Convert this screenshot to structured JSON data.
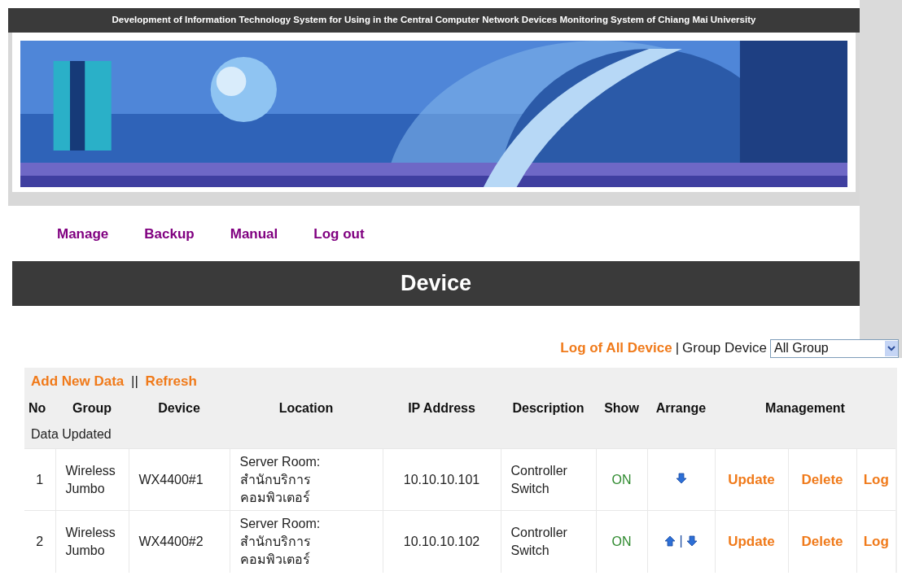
{
  "title_bar": "Development of Information Technology System for Using in the Central Computer Network Devices Monitoring System of Chiang Mai University",
  "nav": [
    "Manage",
    "Backup",
    "Manual",
    "Log out"
  ],
  "section_title": "Device",
  "filter": {
    "log_link": "Log of All Device",
    "separator": "|",
    "label": "Group Device",
    "select_value": "All Group"
  },
  "actions": {
    "add": "Add New Data",
    "separator": "||",
    "refresh": "Refresh"
  },
  "table": {
    "columns": [
      "No",
      "Group",
      "Device",
      "Location",
      "IP Address",
      "Description",
      "Show",
      "Arrange",
      "Management"
    ],
    "subheader": "Data Updated",
    "rows": [
      {
        "no": "1",
        "group": "Wireless Jumbo",
        "device": "WX4400#1",
        "location": [
          "Server Room:",
          "สำนักบริการ",
          "คอมพิวเตอร์"
        ],
        "ip": "10.10.10.101",
        "description": "Controller Switch",
        "show": "ON",
        "arrange": {
          "up": false,
          "down": true
        },
        "update": "Update",
        "delete": "Delete",
        "log": "Log"
      },
      {
        "no": "2",
        "group": "Wireless Jumbo",
        "device": "WX4400#2",
        "location": [
          "Server Room:",
          "สำนักบริการ",
          "คอมพิวเตอร์"
        ],
        "ip": "10.10.10.102",
        "description": "Controller Switch",
        "show": "ON",
        "arrange": {
          "up": true,
          "separator": "|",
          "down": true
        },
        "update": "Update",
        "delete": "Delete",
        "log": "Log"
      }
    ]
  }
}
